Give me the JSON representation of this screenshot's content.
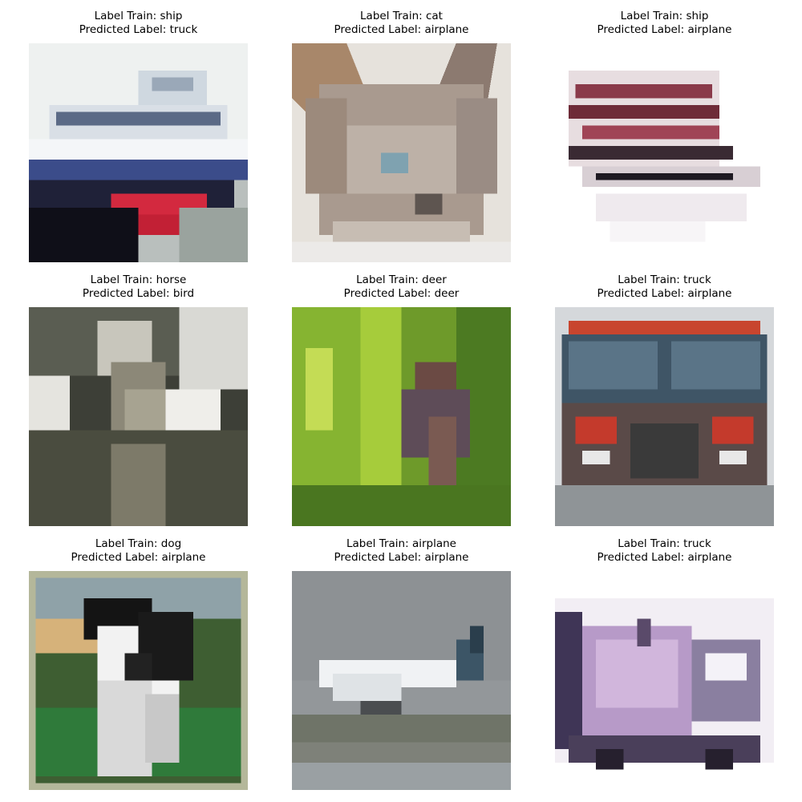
{
  "grid": [
    {
      "label": "Label Train: ship",
      "predicted": "Predicted Label: truck",
      "image": "ship-photo"
    },
    {
      "label": "Label Train: cat",
      "predicted": "Predicted Label: airplane",
      "image": "cat-photo"
    },
    {
      "label": "Label Train: ship",
      "predicted": "Predicted Label: airplane",
      "image": "ship-photo"
    },
    {
      "label": "Label Train: horse",
      "predicted": "Predicted Label: bird",
      "image": "horse-photo"
    },
    {
      "label": "Label Train: deer",
      "predicted": "Predicted Label: deer",
      "image": "deer-photo"
    },
    {
      "label": "Label Train: truck",
      "predicted": "Predicted Label: airplane",
      "image": "truck-photo"
    },
    {
      "label": "Label Train: dog",
      "predicted": "Predicted Label: airplane",
      "image": "dog-photo"
    },
    {
      "label": "Label Train: airplane",
      "predicted": "Predicted Label: airplane",
      "image": "airplane-photo"
    },
    {
      "label": "Label Train: truck",
      "predicted": "Predicted Label: airplane",
      "image": "truck-photo"
    }
  ]
}
